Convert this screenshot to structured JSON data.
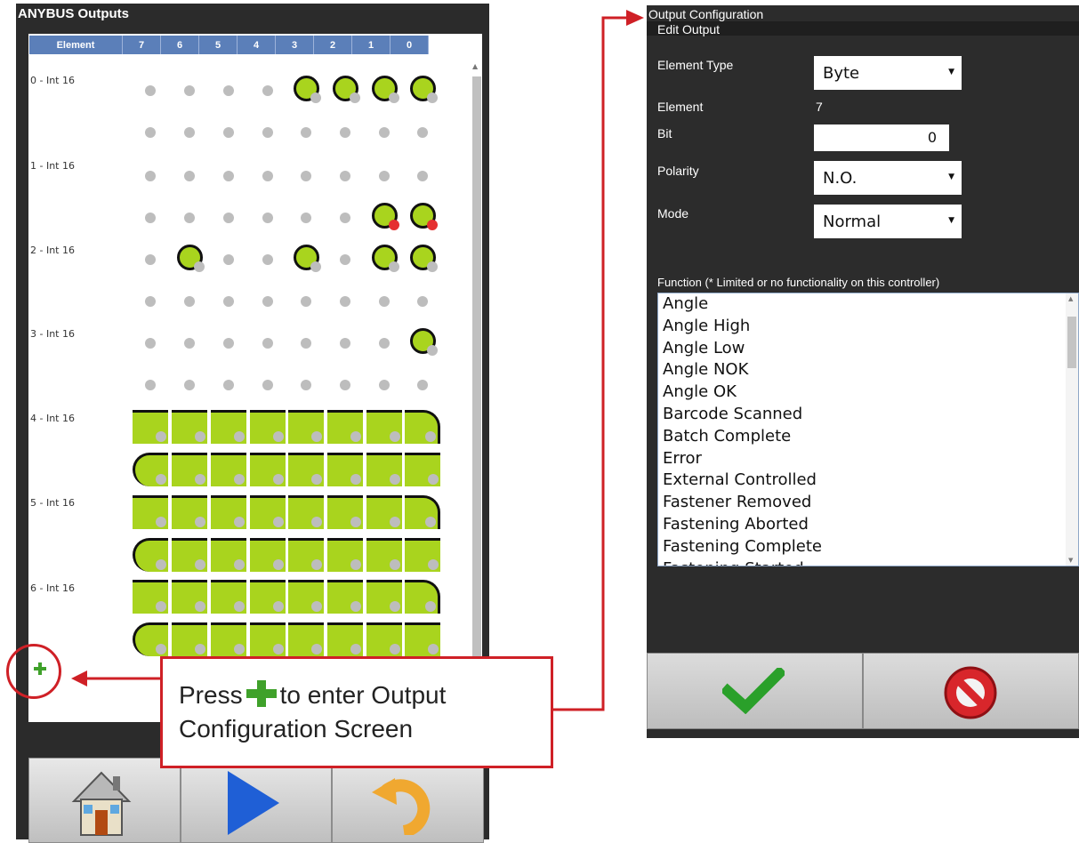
{
  "left": {
    "title": "ANYBUS Outputs",
    "header": {
      "element": "Element",
      "bits": [
        "7",
        "6",
        "5",
        "4",
        "3",
        "2",
        "1",
        "0"
      ]
    },
    "rows": [
      "0 - Int 16",
      "1 - Int 16",
      "2 - Int 16",
      "3 - Int 16",
      "4 - Int 16",
      "5 - Int 16",
      "6 - Int 16"
    ],
    "add_icon": "plus-icon",
    "bottom_buttons": [
      "home-icon",
      "play-icon",
      "undo-icon"
    ]
  },
  "callout": {
    "prefix": "Press",
    "suffix": "to enter Output Configuration Screen"
  },
  "right": {
    "title": "Output Configuration",
    "section": "Edit Output",
    "fields": {
      "element_type": {
        "label": "Element Type",
        "value": "Byte"
      },
      "element": {
        "label": "Element",
        "value": "7"
      },
      "bit": {
        "label": "Bit",
        "value": "0"
      },
      "polarity": {
        "label": "Polarity",
        "value": "N.O."
      },
      "mode": {
        "label": "Mode",
        "value": "Normal"
      }
    },
    "function_label": "Function (* Limited or no functionality on this controller)",
    "functions": [
      "Angle",
      "Angle High",
      "Angle Low",
      "Angle NOK",
      "Angle OK",
      "Barcode Scanned",
      "Batch Complete",
      "Error",
      "External Controlled",
      "Fastener Removed",
      "Fastening Aborted",
      "Fastening Complete",
      "Fastening Started"
    ],
    "buttons": [
      "check-icon",
      "cancel-icon"
    ]
  },
  "colors": {
    "active": "#a9d41e",
    "accent": "#cf2026",
    "header": "#5b7fb9",
    "panel": "#2b2b2b"
  }
}
